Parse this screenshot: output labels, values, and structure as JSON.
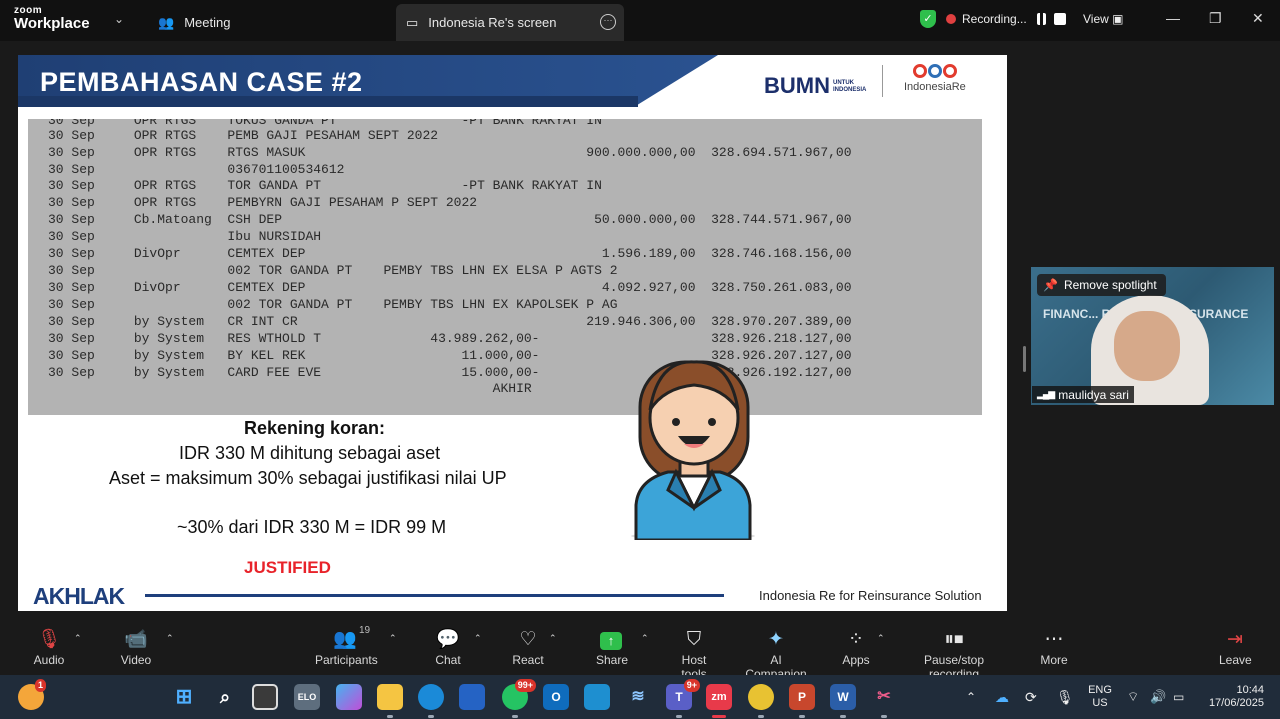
{
  "titlebar": {
    "brand_top": "zoom",
    "brand_bottom": "Workplace",
    "tab_meeting": "Meeting",
    "tab_screen": "Indonesia Re's screen",
    "recording_label": "Recording...",
    "view_label": "View"
  },
  "slide": {
    "title": "PEMBAHASAN CASE #2",
    "bumn_logo_text": "BUMN",
    "bumn_sub": "UNTUK INDONESIA",
    "indonesiare_label": "IndonesiaRe",
    "bank_statement_rows": [
      "30 Sep     OPR RTGS    TOKUS GANDA PT                -PT BANK RAKYAT IN",
      "30 Sep     OPR RTGS    PEMB GAJI PESAHAM SEPT 2022",
      "30 Sep     OPR RTGS    RTGS MASUK                                    900.000.000,00  328.694.571.967,00",
      "30 Sep                 036701100534612",
      "30 Sep     OPR RTGS    TOR GANDA PT                  -PT BANK RAKYAT IN",
      "30 Sep     OPR RTGS    PEMBYRN GAJI PESAHAM P SEPT 2022",
      "30 Sep     Cb.Matoang  CSH DEP                                        50.000.000,00  328.744.571.967,00",
      "30 Sep                 Ibu NURSIDAH",
      "30 Sep     DivOpr      CEMTEX DEP                                      1.596.189,00  328.746.168.156,00",
      "30 Sep                 002 TOR GANDA PT    PEMBY TBS LHN EX ELSA P AGTS 2",
      "30 Sep     DivOpr      CEMTEX DEP                                      4.092.927,00  328.750.261.083,00",
      "30 Sep                 002 TOR GANDA PT    PEMBY TBS LHN EX KAPOLSEK P AG",
      "30 Sep     by System   CR INT CR                                     219.946.306,00  328.970.207.389,00",
      "30 Sep     by System   RES WTHOLD T              43.989.262,00-                      328.926.218.127,00",
      "30 Sep     by System   BY KEL REK                    11.000,00-                      328.926.207.127,00",
      "30 Sep     by System   CARD FEE EVE                  15.000,00-                      328.926.192.127,00",
      "                                                         AKHIR                   G"
    ],
    "heading": "Rekening koran:",
    "line1": "IDR 330 M dihitung sebagai aset",
    "line2": "Aset = maksimum 30% sebagai justifikasi nilai UP",
    "line3": "~30% dari IDR 330 M = IDR 99 M",
    "verdict": "JUSTIFIED",
    "akhlak": "AKHLAK",
    "footer": "Indonesia Re for Reinsurance Solution",
    "colors": {
      "header_blue": "#1f3f74",
      "verdict_red": "#e8232a"
    }
  },
  "video_tile": {
    "spotlight_button": "Remove spotlight",
    "participant_name": "maulidya sari",
    "background_text": "FINANC...  RITING & CO... SURANCE"
  },
  "toolbar": {
    "audio": "Audio",
    "video": "Video",
    "participants": "Participants",
    "participants_count": "19",
    "chat": "Chat",
    "react": "React",
    "share": "Share",
    "host_tools": "Host tools",
    "ai_companion": "AI Companion",
    "apps": "Apps",
    "pause_recording": "Pause/stop recording",
    "more": "More",
    "leave": "Leave"
  },
  "taskbar": {
    "notif_badge": "1",
    "whatsapp_badge": "99+",
    "teams_badge": "9+",
    "lang_line1": "ENG",
    "lang_line2": "US",
    "time": "10:44",
    "date": "17/06/2025"
  }
}
